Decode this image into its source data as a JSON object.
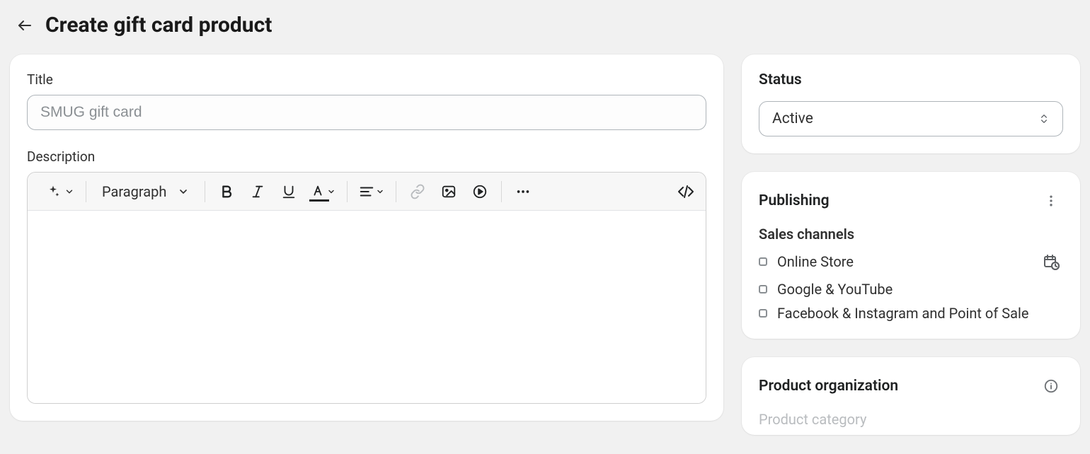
{
  "header": {
    "title": "Create gift card product"
  },
  "main": {
    "title_label": "Title",
    "title_placeholder": "SMUG gift card",
    "title_value": "",
    "description_label": "Description",
    "paragraph_label": "Paragraph"
  },
  "status": {
    "heading": "Status",
    "value": "Active"
  },
  "publishing": {
    "heading": "Publishing",
    "sub_heading": "Sales channels",
    "channels": [
      {
        "label": "Online Store",
        "has_schedule": true
      },
      {
        "label": "Google & YouTube",
        "has_schedule": false
      },
      {
        "label": "Facebook & Instagram and Point of Sale",
        "has_schedule": false
      }
    ]
  },
  "organization": {
    "heading": "Product organization",
    "category_label": "Product category"
  }
}
